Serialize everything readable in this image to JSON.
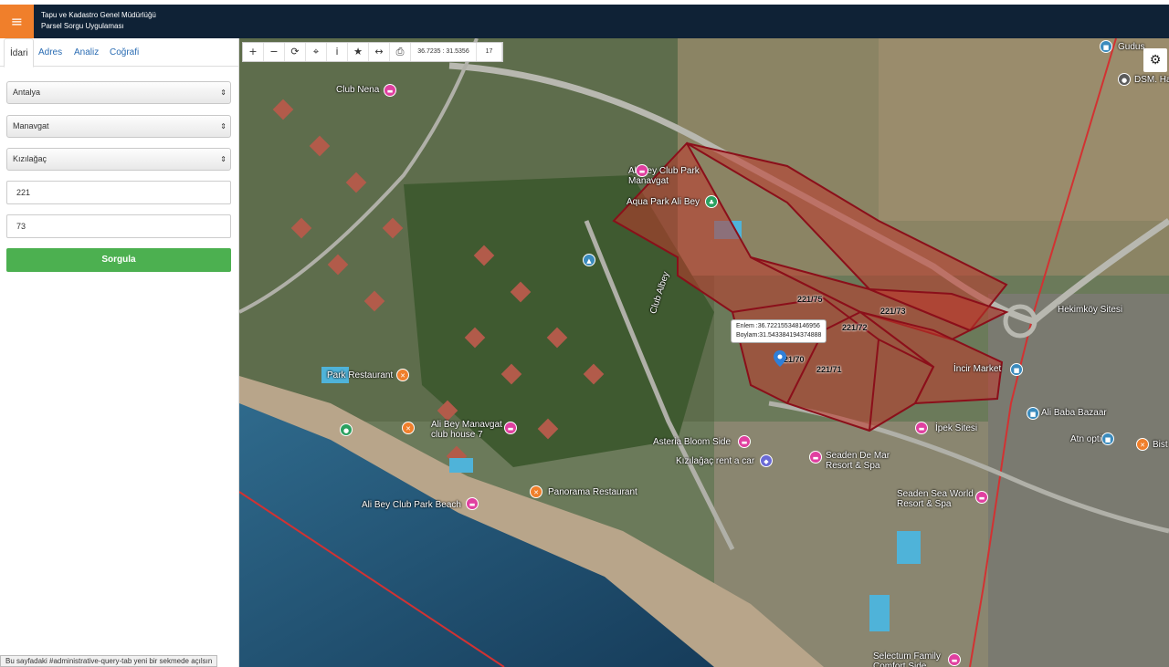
{
  "app": {
    "title_line1": "Tapu ve Kadastro Genel Müdürlüğü",
    "title_line2": "Parsel Sorgu Uygulaması"
  },
  "tabs": [
    "İdari",
    "Adres",
    "Analiz",
    "Coğrafi"
  ],
  "form": {
    "province": "Antalya",
    "district": "Manavgat",
    "neighborhood": "Kızılağaç",
    "block": "221",
    "parcel": "73",
    "submit_label": "Sorgula"
  },
  "toolbar": {
    "coordinates": "36.7235 : 31.5356",
    "zoom": "17"
  },
  "popup": {
    "lat_line": "Enlem :36.722155348146956",
    "lon_line": "Boylam:31.543384194374888"
  },
  "parcels": [
    "221/75",
    "221/73",
    "221/72",
    "221/70",
    "221/71"
  ],
  "places": [
    "Club Nena",
    "Ali Bey Club Park Manavgat",
    "Aqua Park Ali Bey",
    "Park Restaurant",
    "Ali Bey Manavgat club house 7",
    "Ali Bey Club Park Beach",
    "Panorama Restaurant",
    "Asteria Bloom Side",
    "Kızılağaç rent a car",
    "Seaden De Mar Resort & Spa",
    "Seaden Sea World Resort & Spa",
    "İpek Sitesi",
    "Ali Baba Bazaar",
    "Atn optik",
    "İncir Market",
    "Hekimköy Sitesi",
    "Selectum Family Comfort Side",
    "DSM. Ha",
    "Gudus",
    "Bist",
    "Club Albey"
  ],
  "status_text": "Bu sayfadaki #administrative-query-tab yeni bir sekmede açılsın",
  "colors": {
    "header": "#0f2236",
    "accent": "#f07f2b",
    "submit": "#4cb050",
    "parcel_fill": "#c0392b"
  }
}
